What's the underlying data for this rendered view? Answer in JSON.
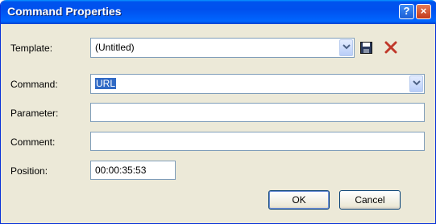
{
  "window": {
    "title": "Command Properties",
    "help_label": "?",
    "close_label": "×"
  },
  "template": {
    "label": "Template:",
    "value": "(Untitled)",
    "save_icon": "floppy-disk-icon",
    "delete_icon": "red-x-icon"
  },
  "command": {
    "label": "Command:",
    "value": "URL"
  },
  "parameter": {
    "label": "Parameter:",
    "value": ""
  },
  "comment": {
    "label": "Comment:",
    "value": ""
  },
  "position": {
    "label": "Position:",
    "value": "00:00:35:53"
  },
  "buttons": {
    "ok": "OK",
    "cancel": "Cancel"
  },
  "colors": {
    "title_bar": "#0054e3",
    "dialog_bg": "#ece9d8",
    "selection": "#316ac5",
    "delete_icon": "#c0392b"
  }
}
